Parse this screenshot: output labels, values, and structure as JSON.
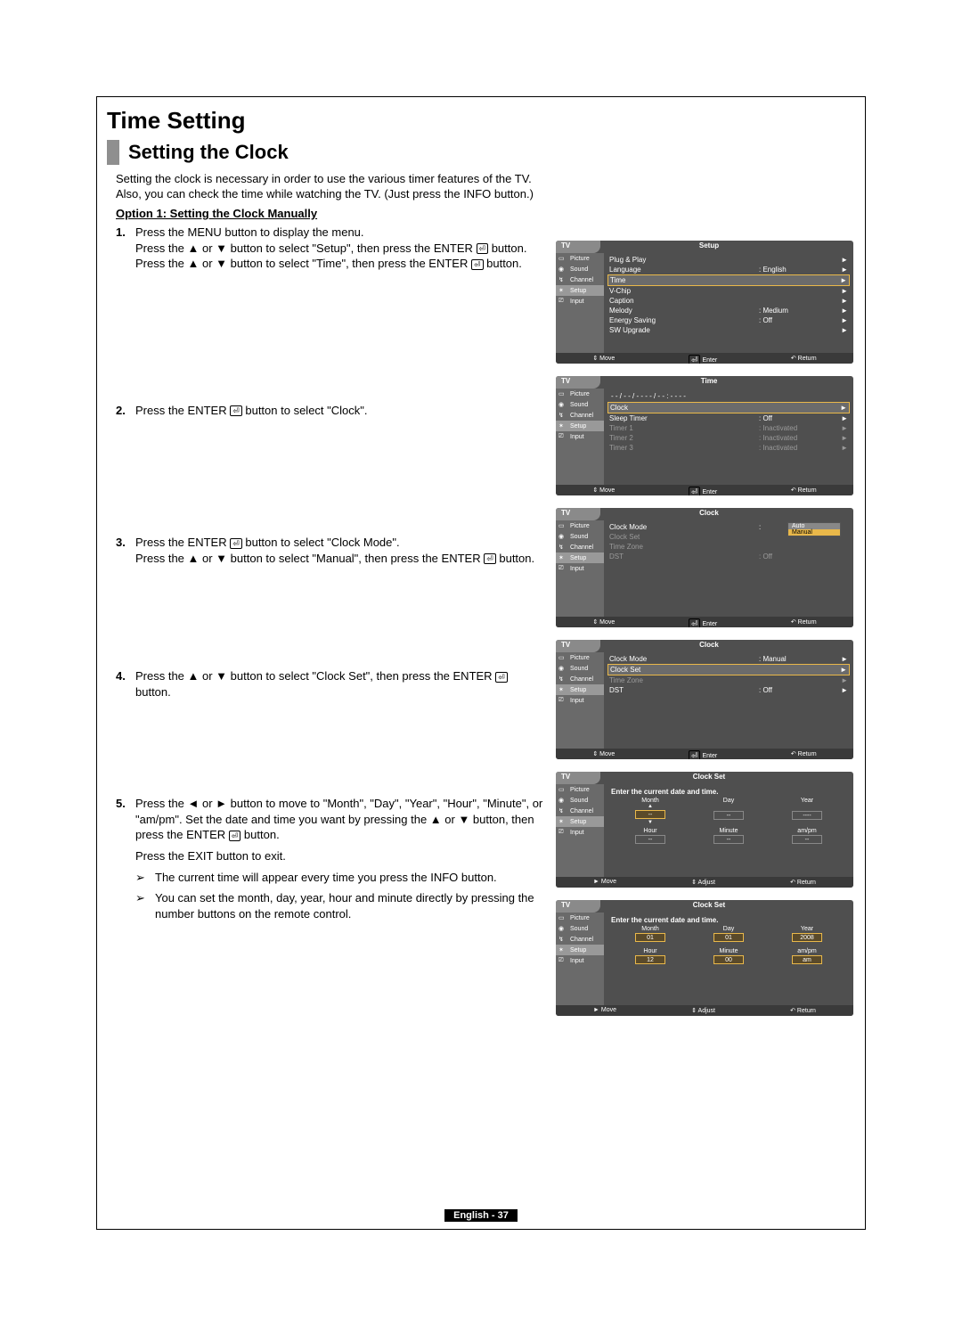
{
  "heading1": "Time Setting",
  "heading2": "Setting the Clock",
  "intro_line1": "Setting the clock is necessary in order to use the various timer features of the TV.",
  "intro_line2": "Also, you can check the time while watching the TV. (Just press the INFO button.)",
  "option1": "Option 1: Setting the Clock Manually",
  "steps": {
    "s1n": "1.",
    "s1a": "Press the MENU button to display the menu.",
    "s1b": "Press the ▲ or ▼ button to select \"Setup\", then press the ENTER ",
    "s1b2": " button.",
    "s1c": "Press the ▲ or ▼ button to select \"Time\", then press the ENTER ",
    "s1c2": " button.",
    "s2n": "2.",
    "s2a": "Press the ENTER ",
    "s2a2": " button to select \"Clock\".",
    "s3n": "3.",
    "s3a": "Press the ENTER ",
    "s3a2": " button to select \"Clock Mode\".",
    "s3b": "Press the ▲ or ▼ button to select \"Manual\", then press the ENTER ",
    "s3b2": " button.",
    "s4n": "4.",
    "s4a": "Press the ▲ or ▼ button to select \"Clock Set\", then press the ENTER ",
    "s4a2": " button.",
    "s5n": "5.",
    "s5a": "Press the ◄ or ► button to move to \"Month\", \"Day\", \"Year\", \"Hour\", \"Minute\", or \"am/pm\". Set the date and time you want by pressing the ▲ or ▼ button, then press the ENTER ",
    "s5a2": " button.",
    "s5b": "Press the EXIT button to exit.",
    "n1": "The current time will appear every time you press the INFO button.",
    "n2": "You can set the month, day, year, hour and minute directly by pressing the number buttons on the remote control."
  },
  "sidebar": {
    "picture": "Picture",
    "sound": "Sound",
    "channel": "Channel",
    "setup": "Setup",
    "input": "Input"
  },
  "footer": {
    "move": "Move",
    "enter": "Enter",
    "return": "Return",
    "adjust": "Adjust"
  },
  "menu1": {
    "tv": "TV",
    "title": "Setup",
    "rows": [
      {
        "l": "Plug & Play",
        "v": "",
        "a": "►"
      },
      {
        "l": "Language",
        "v": ": English",
        "a": "►"
      },
      {
        "l": "Time",
        "v": "",
        "a": "►",
        "hl": true
      },
      {
        "l": "V-Chip",
        "v": "",
        "a": "►"
      },
      {
        "l": "Caption",
        "v": "",
        "a": "►"
      },
      {
        "l": "Melody",
        "v": ": Medium",
        "a": "►"
      },
      {
        "l": "Energy Saving",
        "v": ": Off",
        "a": "►"
      },
      {
        "l": "SW Upgrade",
        "v": "",
        "a": "►"
      }
    ]
  },
  "menu2": {
    "tv": "TV",
    "title": "Time",
    "timestr": "- - / - - / - - - - / - - : - -   - -",
    "rows": [
      {
        "l": "Clock",
        "v": "",
        "a": "►",
        "hl": true
      },
      {
        "l": "Sleep Timer",
        "v": ": Off",
        "a": "►"
      },
      {
        "l": "Timer 1",
        "v": ": Inactivated",
        "a": "►",
        "dim": true
      },
      {
        "l": "Timer 2",
        "v": ": Inactivated",
        "a": "►",
        "dim": true
      },
      {
        "l": "Timer 3",
        "v": ": Inactivated",
        "a": "►",
        "dim": true
      }
    ]
  },
  "menu3": {
    "tv": "TV",
    "title": "Clock",
    "rows": [
      {
        "l": "Clock Mode",
        "v": ":",
        "a": ""
      },
      {
        "l": "Clock Set",
        "v": "",
        "a": "",
        "dim": true
      },
      {
        "l": "Time Zone",
        "v": "",
        "a": "",
        "dim": true
      },
      {
        "l": "DST",
        "v": ": Off",
        "a": "",
        "dim": true
      }
    ],
    "dd": {
      "auto": "Auto",
      "manual": "Manual"
    }
  },
  "menu4": {
    "tv": "TV",
    "title": "Clock",
    "rows": [
      {
        "l": "Clock Mode",
        "v": ": Manual",
        "a": "►"
      },
      {
        "l": "Clock Set",
        "v": "",
        "a": "►",
        "hl": true
      },
      {
        "l": "Time Zone",
        "v": "",
        "a": "►",
        "dim": true
      },
      {
        "l": "DST",
        "v": ": Off",
        "a": "►"
      }
    ]
  },
  "menu5": {
    "tv": "TV",
    "title": "Clock Set",
    "prompt": "Enter the current date and time.",
    "hdr": {
      "month": "Month",
      "day": "Day",
      "year": "Year",
      "hour": "Hour",
      "minute": "Minute",
      "ampm": "am/pm"
    },
    "vals": {
      "month": "--",
      "day": "--",
      "year": "----",
      "hour": "--",
      "minute": "--",
      "ampm": "--"
    }
  },
  "menu6": {
    "tv": "TV",
    "title": "Clock Set",
    "prompt": "Enter the current date and time.",
    "hdr": {
      "month": "Month",
      "day": "Day",
      "year": "Year",
      "hour": "Hour",
      "minute": "Minute",
      "ampm": "am/pm"
    },
    "vals": {
      "month": "01",
      "day": "01",
      "year": "2008",
      "hour": "12",
      "minute": "00",
      "ampm": "am"
    }
  },
  "noteicon": "➢",
  "enter_glyph": "⏎",
  "updown": "⇕",
  "leftright": "◄►",
  "ret": "↶",
  "footer_move_lr": "► Move",
  "pagefooter": "English - 37"
}
